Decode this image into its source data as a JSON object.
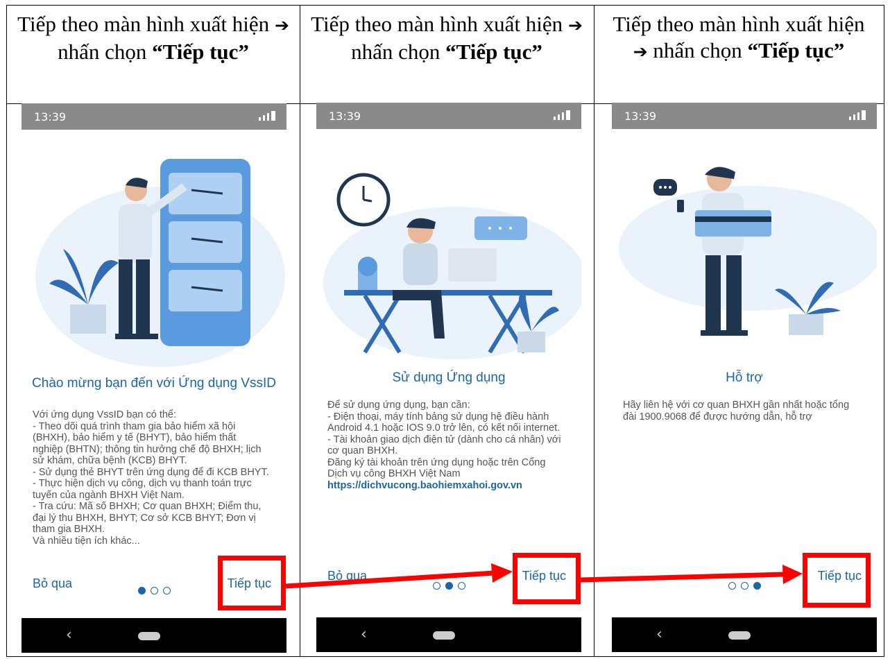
{
  "headers": [
    {
      "pre": "Tiếp theo màn hình xuất hiện ",
      "arrow": "➔",
      "mid": " nhấn chọn ",
      "bold": "“Tiếp tục”"
    },
    {
      "pre": "Tiếp theo màn hình xuất hiện ",
      "arrow": "➔",
      "mid": " nhấn chọn ",
      "bold": "“Tiếp tục”"
    },
    {
      "pre": "Tiếp theo màn hình xuất hiện ",
      "arrow": "➔",
      "mid": " nhấn chọn ",
      "bold": "“Tiếp tục”"
    }
  ],
  "screens": [
    {
      "time": "13:39",
      "title": "Chào mừng bạn đến với Ứng dụng VssID",
      "body": [
        "Với ứng dụng VssID bạn có thể:",
        "- Theo dõi quá trình tham gia bảo hiểm xã hội",
        "(BHXH), bảo hiểm y tế (BHYT), bảo hiểm thất",
        "nghiệp (BHTN); thông tin hưởng chế độ BHXH; lịch",
        "sử khám, chữa bệnh (KCB) BHYT.",
        "- Sử dụng thẻ BHYT trên ứng dụng để đi KCB BHYT.",
        "- Thực hiện dịch vụ công, dịch vụ thanh toán trực",
        "tuyến của ngành BHXH Việt Nam.",
        "- Tra cứu: Mã số BHXH; Cơ quan BHXH; Điểm thu,",
        "đại lý thu BHXH, BHYT; Cơ sở KCB BHYT; Đơn vị",
        "tham gia BHXH.",
        "Và nhiều tiện ích khác..."
      ],
      "link": "",
      "skip": "Bỏ qua",
      "next": "Tiếp tục",
      "active_dot": 0
    },
    {
      "time": "13:39",
      "title": "Sử dụng Ứng dụng",
      "body": [
        "Để sử dụng ứng dụng, bạn cần:",
        "- Điện thoại, máy tính bảng sử dụng hệ điều hành",
        "Android 4.1 hoặc IOS 9.0 trở lên, có kết nối internet.",
        "- Tài khoản giao dịch điện tử (dành cho cá nhân) với",
        "cơ quan BHXH.",
        "Đăng ký tài khoản trên ứng dụng hoặc trên Cổng",
        "Dịch vụ công BHXH Việt Nam"
      ],
      "link": "https://dichvucong.baohiemxahoi.gov.vn",
      "skip": "Bỏ qua",
      "next": "Tiếp tục",
      "active_dot": 1
    },
    {
      "time": "13:39",
      "title": "Hỗ trợ",
      "body": [
        "Hãy liên hệ với cơ quan BHXH gần nhất hoặc tổng",
        "đài 1900.9068 để được hướng dẫn, hỗ trợ"
      ],
      "link": "",
      "skip": "",
      "next": "Tiếp tục",
      "active_dot": 2
    }
  ],
  "colors": {
    "accent": "#1a66a8",
    "highlight": "#ff0000",
    "statusbar": "#8a8a8a",
    "illustration_blue": "#7fb3e8",
    "illustration_navy": "#1f3550"
  }
}
